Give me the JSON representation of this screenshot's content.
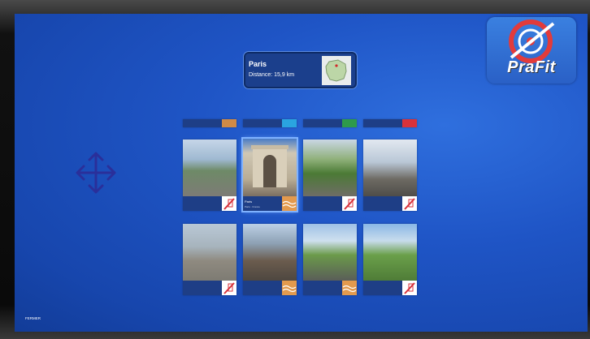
{
  "brand": {
    "logo_text": "PraFit"
  },
  "info_card": {
    "title": "Paris",
    "distance": "Distance: 15,9 km"
  },
  "tiles": [
    {
      "name": "",
      "region": "",
      "badge": "orange"
    },
    {
      "name": "",
      "region": "",
      "badge": "cyan"
    },
    {
      "name": "",
      "region": "",
      "badge": "green"
    },
    {
      "name": "",
      "region": "",
      "badge": "red"
    },
    {
      "name": "",
      "region": "",
      "badge": "red-route"
    },
    {
      "name": "Paris",
      "region": "Paris · France",
      "badge": "orange"
    },
    {
      "name": "",
      "region": "",
      "badge": "red-route"
    },
    {
      "name": "",
      "region": "",
      "badge": "red-route"
    },
    {
      "name": "",
      "region": "",
      "badge": "red-route"
    },
    {
      "name": "",
      "region": "",
      "badge": "orange"
    },
    {
      "name": "",
      "region": "",
      "badge": "orange"
    },
    {
      "name": "",
      "region": "",
      "badge": "red"
    }
  ],
  "footer": {
    "close_label": "FERMER"
  }
}
